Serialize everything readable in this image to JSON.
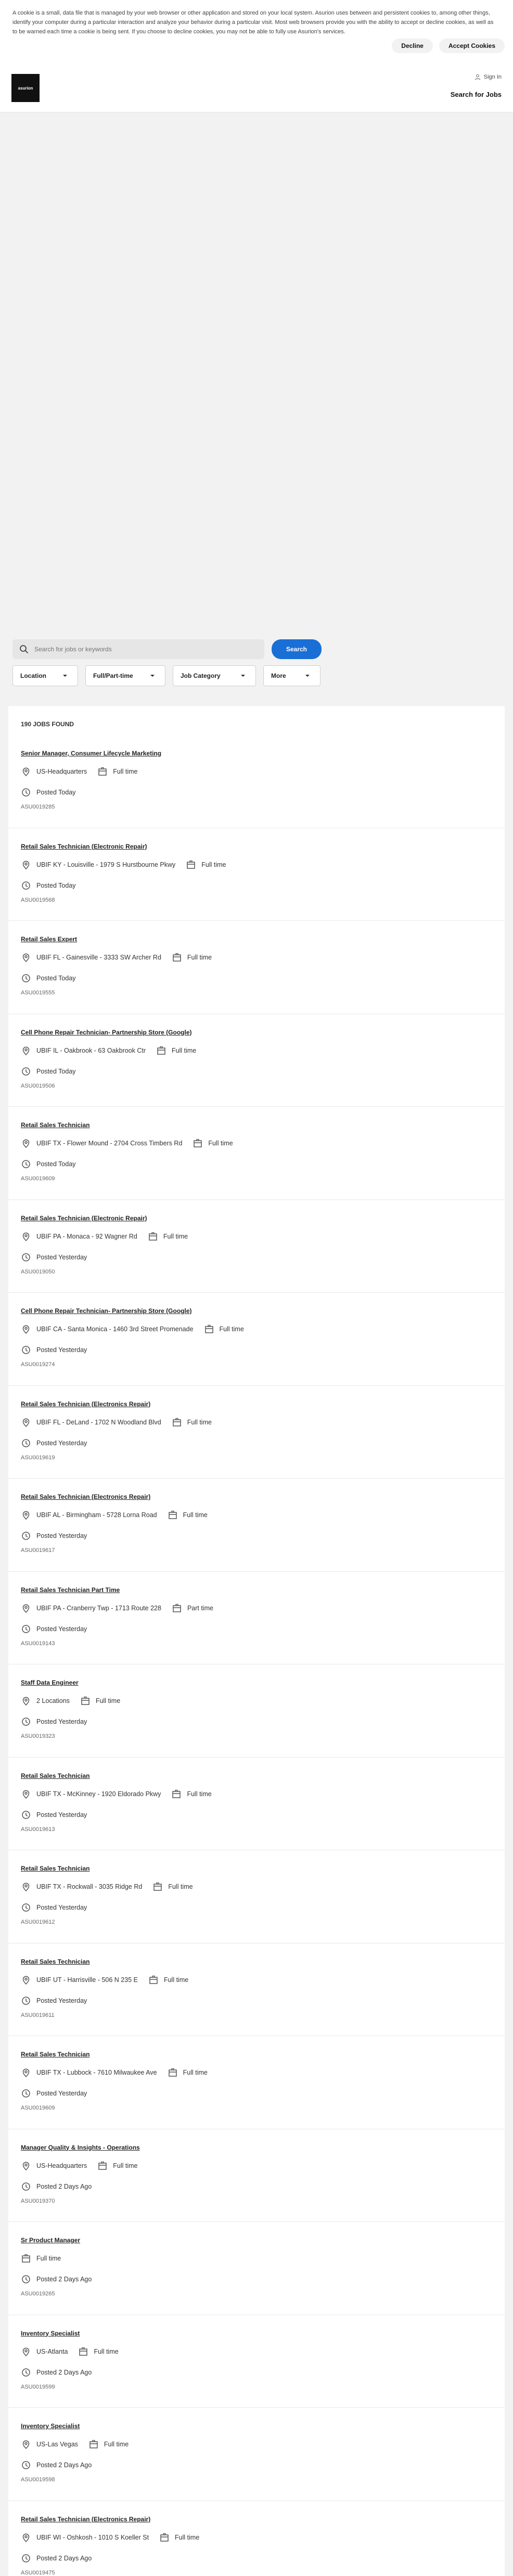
{
  "cookie": {
    "text": "A cookie is a small, data file that is managed by your web browser or other application and stored on your local system. Asurion uses between and persistent cookies to, among other things, identify your computer during a particular interaction and analyze your behavior during a particular visit. Most web browsers provide you with the ability to accept or decline cookies, as well as to be warned each time a cookie is being sent. If you choose to decline cookies, you may not be able to fully use Asurion's services.",
    "decline": "Decline",
    "accept": "Accept Cookies"
  },
  "header": {
    "logo": "asurion",
    "signin": "Sign In",
    "search_jobs": "Search for Jobs"
  },
  "search": {
    "placeholder": "Search for jobs or keywords",
    "button": "Search"
  },
  "filters": [
    "Location",
    "Full/Part-time",
    "Job Category",
    "More"
  ],
  "results": {
    "count": "190 JOBS FOUND"
  },
  "jobs": [
    {
      "title": "Senior Manager, Consumer Lifecycle Marketing",
      "location": "US-Headquarters",
      "type": "Full time",
      "posted": "Posted Today",
      "id": "ASU0019285"
    },
    {
      "title": "Retail Sales Technician (Electronic Repair)",
      "location": "UBIF KY - Louisville - 1979 S Hurstbourne Pkwy",
      "type": "Full time",
      "posted": "Posted Today",
      "id": "ASU0019568"
    },
    {
      "title": "Retail Sales Expert",
      "location": "UBIF FL - Gainesville - 3333 SW Archer Rd",
      "type": "Full time",
      "posted": "Posted Today",
      "id": "ASU0019555"
    },
    {
      "title": "Cell Phone Repair Technician- Partnership Store (Google)",
      "location": "UBIF IL - Oakbrook - 63 Oakbrook Ctr",
      "type": "Full time",
      "posted": "Posted Today",
      "id": "ASU0019506"
    },
    {
      "title": "Retail Sales Technician",
      "location": "UBIF TX - Flower Mound - 2704 Cross Timbers Rd",
      "type": "Full time",
      "posted": "Posted Today",
      "id": "ASU0019609"
    },
    {
      "title": "Retail Sales Technician (Electronic Repair)",
      "location": "UBIF PA - Monaca - 92 Wagner Rd",
      "type": "Full time",
      "posted": "Posted Yesterday",
      "id": "ASU0019050"
    },
    {
      "title": "Cell Phone Repair Technician- Partnership Store (Google)",
      "location": "UBIF CA - Santa Monica - 1460 3rd Street Promenade",
      "type": "Full time",
      "posted": "Posted Yesterday",
      "id": "ASU0019274"
    },
    {
      "title": "Retail Sales Technician (Electronics Repair)",
      "location": "UBIF FL - DeLand - 1702 N Woodland Blvd",
      "type": "Full time",
      "posted": "Posted Yesterday",
      "id": "ASU0019619"
    },
    {
      "title": "Retail Sales Technician (Electronics Repair)",
      "location": "UBIF AL - Birmingham - 5728 Lorna Road",
      "type": "Full time",
      "posted": "Posted Yesterday",
      "id": "ASU0019617"
    },
    {
      "title": "Retail Sales Technician Part Time",
      "location": "UBIF PA - Cranberry Twp - 1713 Route 228",
      "type": "Part time",
      "posted": "Posted Yesterday",
      "id": "ASU0019143"
    },
    {
      "title": "Staff Data Engineer",
      "location": "2 Locations",
      "type": "Full time",
      "posted": "Posted Yesterday",
      "id": "ASU0019323"
    },
    {
      "title": "Retail Sales Technician",
      "location": "UBIF TX - McKinney - 1920 Eldorado Pkwy",
      "type": "Full time",
      "posted": "Posted Yesterday",
      "id": "ASU0019613"
    },
    {
      "title": "Retail Sales Technician",
      "location": "UBIF TX - Rockwall - 3035 Ridge Rd",
      "type": "Full time",
      "posted": "Posted Yesterday",
      "id": "ASU0019612"
    },
    {
      "title": "Retail Sales Technician",
      "location": "UBIF UT - Harrisville - 506 N 235 E",
      "type": "Full time",
      "posted": "Posted Yesterday",
      "id": "ASU0019611"
    },
    {
      "title": "Retail Sales Technician",
      "location": "UBIF TX - Lubbock - 7610 Milwaukee Ave",
      "type": "Full time",
      "posted": "Posted Yesterday",
      "id": "ASU0019609"
    },
    {
      "title": "Manager Quality & Insights - Operations",
      "location": "US-Headquarters",
      "type": "Full time",
      "posted": "Posted 2 Days Ago",
      "id": "ASU0019370"
    },
    {
      "title": "Sr Product Manager",
      "location": "",
      "type": "Full time",
      "posted": "Posted 2 Days Ago",
      "id": "ASU0019265"
    },
    {
      "title": "Inventory Specialist",
      "location": "US-Atlanta",
      "type": "Full time",
      "posted": "Posted 2 Days Ago",
      "id": "ASU0019599"
    },
    {
      "title": "Inventory Specialist",
      "location": "US-Las Vegas",
      "type": "Full time",
      "posted": "Posted 2 Days Ago",
      "id": "ASU0019598"
    },
    {
      "title": "Retail Sales Technician (Electronics Repair)",
      "location": "UBIF WI - Oshkosh - 1010 S Koeller St",
      "type": "Full time",
      "posted": "Posted 2 Days Ago",
      "id": "ASU0019475"
    }
  ]
}
